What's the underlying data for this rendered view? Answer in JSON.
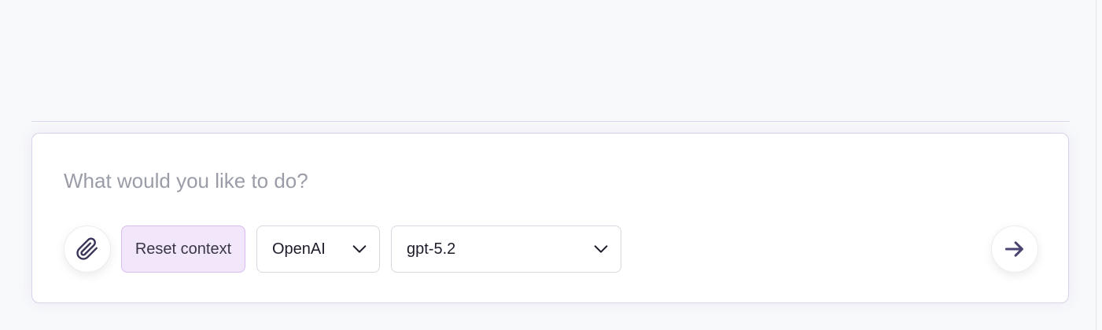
{
  "composer": {
    "placeholder": "What would you like to do?",
    "value": ""
  },
  "toolbar": {
    "attach_icon": "paperclip-icon",
    "reset_label": "Reset context",
    "provider": {
      "selected": "OpenAI",
      "icon": "chevron-down-icon"
    },
    "model": {
      "selected": "gpt-5.2",
      "icon": "chevron-down-icon"
    },
    "send_icon": "arrow-right-icon"
  },
  "colors": {
    "background": "#f8f9fb",
    "accent_fill": "#f1e6fa",
    "accent_border": "#d8bcf0",
    "icon": "#4a4470"
  }
}
